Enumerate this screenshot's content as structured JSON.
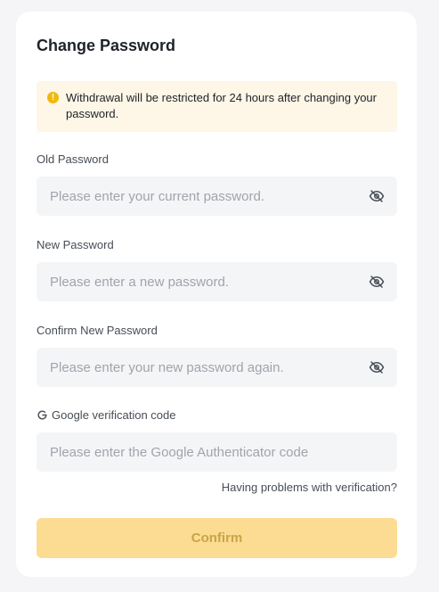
{
  "title": "Change Password",
  "notice": {
    "icon": "warning-icon",
    "text": "Withdrawal will be restricted for 24 hours after changing your password."
  },
  "fields": [
    {
      "label": "Old Password",
      "placeholder": "Please enter your current password.",
      "icon": "eye-hidden-icon"
    },
    {
      "label": "New Password",
      "placeholder": "Please enter a new password.",
      "icon": "eye-hidden-icon"
    },
    {
      "label": "Confirm New Password",
      "placeholder": "Please enter your new password again.",
      "icon": "eye-hidden-icon"
    },
    {
      "label": "Google verification code",
      "placeholder": "Please enter the Google Authenticator code",
      "icon": "google-icon"
    }
  ],
  "help_link": "Having problems with verification?",
  "confirm_label": "Confirm",
  "colors": {
    "accent": "#fcdc92",
    "notice_bg": "#fef6e6",
    "warning": "#f0b90b",
    "input_bg": "#f4f5f7"
  }
}
